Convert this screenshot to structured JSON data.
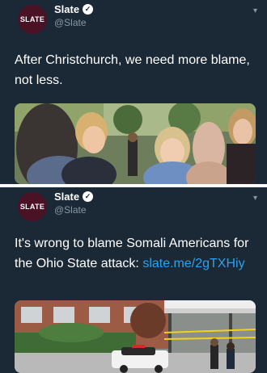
{
  "tweets": [
    {
      "avatar_text": "SLATE",
      "display_name": "Slate",
      "handle": "@Slate",
      "verified_icon": "checkmark-icon",
      "text": "After Christchurch, we need more blame, not less.",
      "media_subject": "photo-embrace"
    },
    {
      "avatar_text": "SLATE",
      "display_name": "Slate",
      "handle": "@Slate",
      "verified_icon": "checkmark-icon",
      "text_before_link": "It's wrong to blame Somali Americans for the Ohio State attack: ",
      "link_text": "slate.me/2gTXHiy",
      "media_subject": "photo-police-scene"
    }
  ],
  "colors": {
    "background": "#1b2836",
    "link": "#2aa3ef",
    "avatar": "#4a1224",
    "handle": "#8899a6"
  }
}
